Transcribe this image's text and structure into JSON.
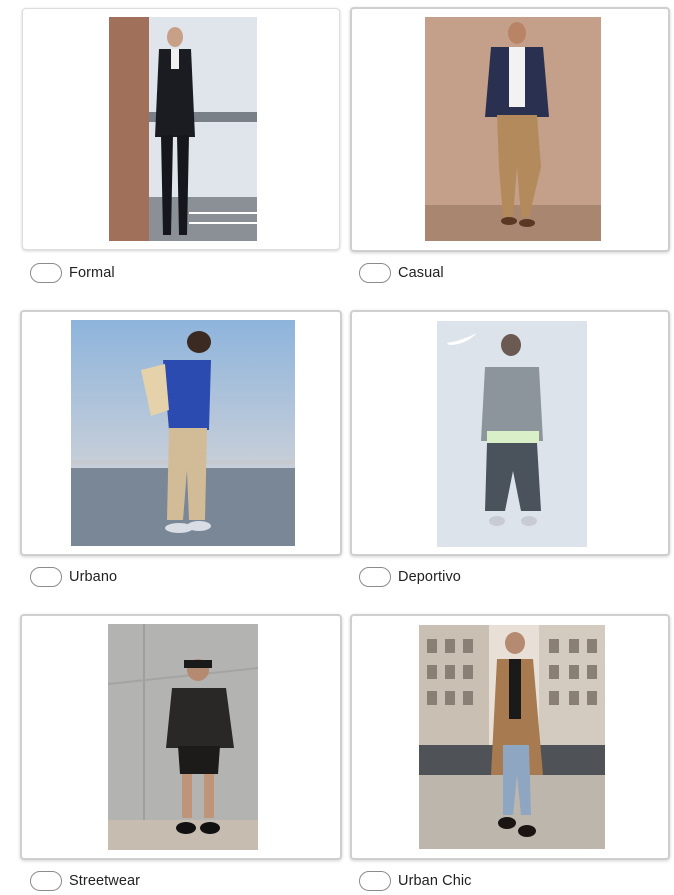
{
  "options": [
    {
      "label": "Formal",
      "photo": "formal-outfit-photo"
    },
    {
      "label": "Casual",
      "photo": "casual-outfit-photo"
    },
    {
      "label": "Urbano",
      "photo": "urban-outfit-photo"
    },
    {
      "label": "Deportivo",
      "photo": "sport-outfit-photo"
    },
    {
      "label": "Streetwear",
      "photo": "streetwear-outfit-photo"
    },
    {
      "label": "Urban Chic",
      "photo": "urban-chic-outfit-photo"
    }
  ],
  "colors": {
    "card_border": "#cfcfcf",
    "radio_border": "#8c8c8c",
    "label_text": "#222222"
  }
}
